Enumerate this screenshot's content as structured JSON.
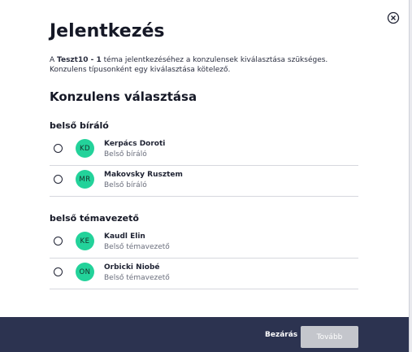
{
  "dialog": {
    "title": "Jelentkezés",
    "intro": {
      "prefix": "A ",
      "topic": "Teszt10 - 1",
      "suffix": " téma jelentkezéséhez a konzulensek kiválasztása szükséges. Konzulens típusonként egy kiválasztása kötelező."
    },
    "section_title": "Konzulens választása"
  },
  "groups": [
    {
      "title": "belső bíráló",
      "consultants": [
        {
          "initials": "KD",
          "name": "Kerpács Doroti",
          "role": "Belső bíráló"
        },
        {
          "initials": "MR",
          "name": "Makovsky Rusztem",
          "role": "Belső bíráló"
        }
      ]
    },
    {
      "title": "belső témavezető",
      "consultants": [
        {
          "initials": "KE",
          "name": "Kaudl Elin",
          "role": "Belső témavezető"
        },
        {
          "initials": "ON",
          "name": "Orbicki Niobé",
          "role": "Belső témavezető"
        }
      ]
    }
  ],
  "footer": {
    "close_label": "Bezárás",
    "next_label": "Tovább"
  },
  "colors": {
    "avatar": "#23d29a",
    "footer": "#2c3350",
    "next_disabled": "#c4c6cc"
  },
  "icons": {
    "close": "close-circle-icon"
  }
}
